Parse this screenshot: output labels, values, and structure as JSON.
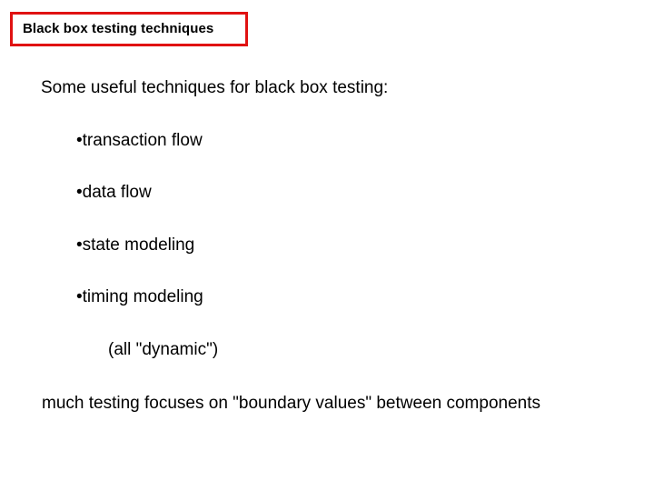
{
  "slide": {
    "title": "Black box testing techniques",
    "title_border_color": "#e01212",
    "background_color": "#ffffff",
    "text_color": "#000000",
    "lead_in": "Some useful techniques for black box testing:",
    "bullet_glyph": "•",
    "bullets": [
      {
        "label": "transaction flow"
      },
      {
        "label": "data flow"
      },
      {
        "label": "state modeling"
      },
      {
        "label": "timing modeling"
      }
    ],
    "note": "(all \"dynamic\")",
    "closing": "much testing focuses on \"boundary values\" between components"
  }
}
